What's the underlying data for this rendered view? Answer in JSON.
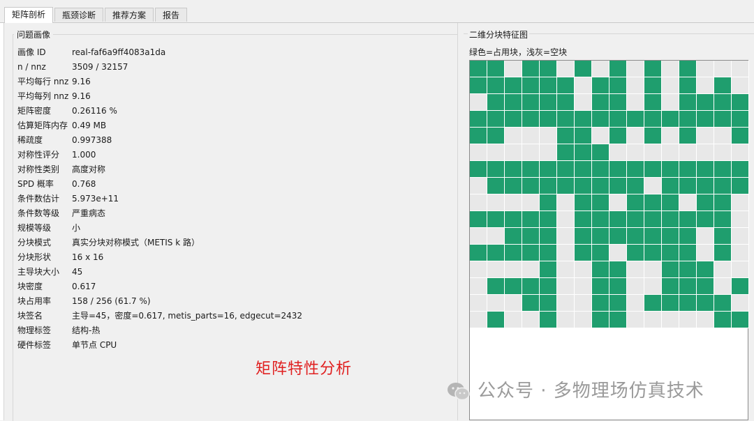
{
  "tabs": [
    "矩阵剖析",
    "瓶颈诊断",
    "推荐方案",
    "报告"
  ],
  "active_tab": 0,
  "left_group_title": "问题画像",
  "properties": [
    {
      "key": "画像 ID",
      "value": "real-faf6a9ff4083a1da"
    },
    {
      "key": "n / nnz",
      "value": "3509 / 32157"
    },
    {
      "key": "平均每行 nnz",
      "value": "9.16"
    },
    {
      "key": "平均每列 nnz",
      "value": "9.16"
    },
    {
      "key": "矩阵密度",
      "value": "0.26116 %"
    },
    {
      "key": "估算矩阵内存",
      "value": "0.49 MB"
    },
    {
      "key": "稀疏度",
      "value": "0.997388"
    },
    {
      "key": "对称性评分",
      "value": "1.000"
    },
    {
      "key": "对称性类别",
      "value": "高度对称"
    },
    {
      "key": "SPD 概率",
      "value": "0.768"
    },
    {
      "key": "条件数估计",
      "value": "5.973e+11"
    },
    {
      "key": "条件数等级",
      "value": "严重病态"
    },
    {
      "key": "规模等级",
      "value": "小"
    },
    {
      "key": "分块模式",
      "value": "真实分块对称模式（METIS k 路）"
    },
    {
      "key": "分块形状",
      "value": "16 x 16"
    },
    {
      "key": "主导块大小",
      "value": "45"
    },
    {
      "key": "块密度",
      "value": "0.617"
    },
    {
      "key": "块占用率",
      "value": "158 / 256 (61.7 %)"
    },
    {
      "key": "块签名",
      "value": "主导=45，密度=0.617, metis_parts=16, edgecut=2432"
    },
    {
      "key": "物理标签",
      "value": "结构-热"
    },
    {
      "key": "硬件标签",
      "value": "单节点 CPU"
    }
  ],
  "caption": "矩阵特性分析",
  "right_title": "二维分块特征图",
  "legend": "绿色=占用块，浅灰=空块",
  "colors": {
    "occupied": "#1f9e6e",
    "empty": "#e8e8e8"
  },
  "block_grid": [
    "1101101010101000",
    "1111110110101010",
    "0111110110101111",
    "1111111111111111",
    "1100011010101001",
    "0000011100000000",
    "1111111111111111",
    "0111111111011111",
    "0000101101110110",
    "1111101111111110",
    "0011101111111010",
    "1111101101111010",
    "0000100110011100",
    "0111100110011101",
    "0001100110111110",
    "0100100110000011"
  ],
  "watermark": "公众号 · 多物理场仿真技术"
}
